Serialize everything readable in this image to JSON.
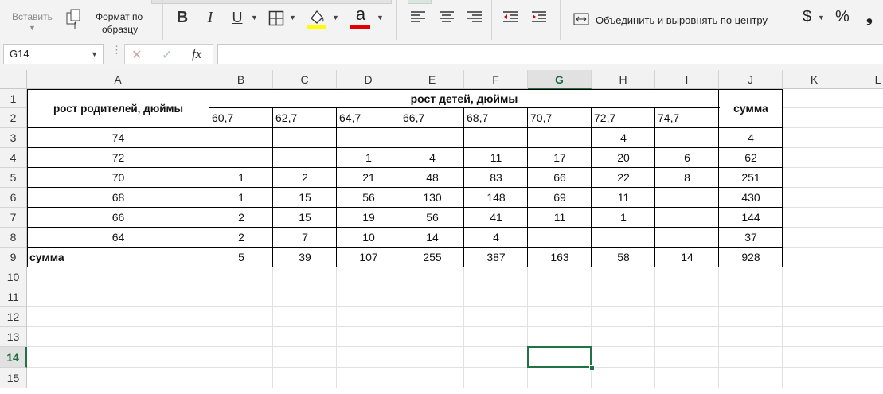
{
  "ribbon": {
    "paste_label": "Вставить",
    "format_painter_label_1": "Формат по",
    "format_painter_label_2": "образцу",
    "bold": "B",
    "italic": "I",
    "underline": "U",
    "font_color_glyph": "a",
    "merge_center_label": "Объединить и выровнять по центру",
    "currency_symbol": "$",
    "percent_symbol": "%",
    "comma_symbol": "❟",
    "colors": {
      "highlight": "#ffff00",
      "font_color": "#e00000",
      "accent": "#217346"
    }
  },
  "formula_bar": {
    "name_box": "G14",
    "fx": "fx",
    "cancel_glyph": "✕",
    "enter_glyph": "✓",
    "formula": ""
  },
  "sheet": {
    "columns": [
      "A",
      "B",
      "C",
      "D",
      "E",
      "F",
      "G",
      "H",
      "I",
      "J",
      "K",
      "L"
    ],
    "rows": [
      "1",
      "2",
      "3",
      "4",
      "5",
      "6",
      "7",
      "8",
      "9",
      "10",
      "11",
      "12",
      "13",
      "14",
      "15"
    ],
    "selected_cell": "G14",
    "headers": {
      "parents": "рост родителей,  дюймы",
      "children": "рост детей, дюймы",
      "sum_col": "сумма",
      "sum_row": "сумма"
    },
    "child_heights": [
      "60,7",
      "62,7",
      "64,7",
      "66,7",
      "68,7",
      "70,7",
      "72,7",
      "74,7"
    ],
    "data_rows": [
      {
        "parent": "74",
        "cells": [
          "",
          "",
          "",
          "",
          "",
          "",
          "4",
          ""
        ],
        "sum": "4"
      },
      {
        "parent": "72",
        "cells": [
          "",
          "",
          "1",
          "4",
          "11",
          "17",
          "20",
          "6"
        ],
        "sum": "62"
      },
      {
        "parent": "70",
        "cells": [
          "1",
          "2",
          "21",
          "48",
          "83",
          "66",
          "22",
          "8"
        ],
        "sum": "251"
      },
      {
        "parent": "68",
        "cells": [
          "1",
          "15",
          "56",
          "130",
          "148",
          "69",
          "11",
          ""
        ],
        "sum": "430"
      },
      {
        "parent": "66",
        "cells": [
          "2",
          "15",
          "19",
          "56",
          "41",
          "11",
          "1",
          ""
        ],
        "sum": "144"
      },
      {
        "parent": "64",
        "cells": [
          "2",
          "7",
          "10",
          "14",
          "4",
          "",
          "",
          ""
        ],
        "sum": "37"
      }
    ],
    "totals": [
      "5",
      "39",
      "107",
      "255",
      "387",
      "163",
      "58",
      "14"
    ],
    "grand_total": "928"
  }
}
